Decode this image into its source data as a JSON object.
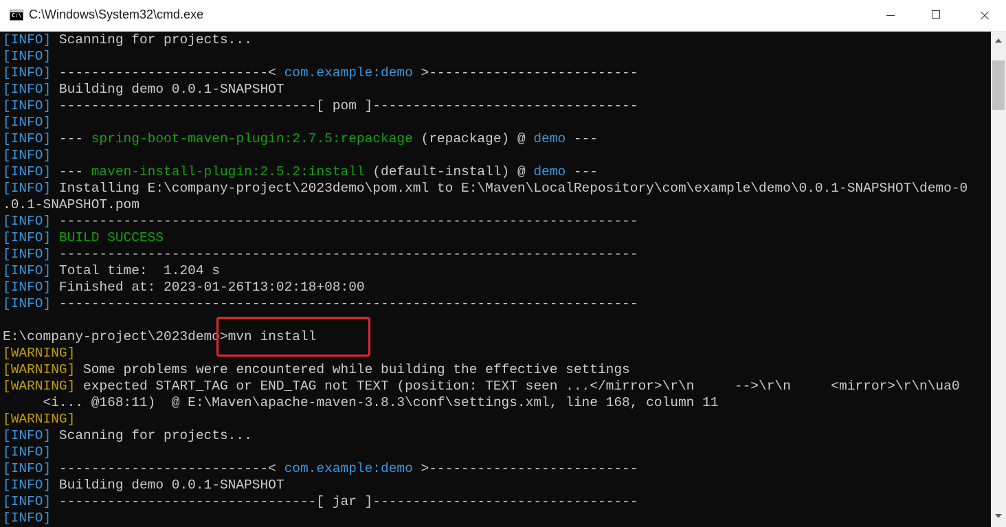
{
  "window": {
    "title": "C:\\Windows\\System32\\cmd.exe",
    "icon_name": "cmd-icon",
    "icon_text": "C:\\",
    "controls": [
      "minimize",
      "maximize",
      "close"
    ]
  },
  "colors": {
    "info": "#3a96dd",
    "warning": "#c19c00",
    "green": "#13a10e",
    "text": "#cccccc",
    "background": "#0c0c0c",
    "highlight": "#e8242c"
  },
  "console": {
    "lines": [
      [
        {
          "t": "[INFO]",
          "c": "info"
        },
        {
          "t": " Scanning for projects..."
        }
      ],
      [
        {
          "t": "[INFO]",
          "c": "info"
        }
      ],
      [
        {
          "t": "[INFO]",
          "c": "info"
        },
        {
          "t": " --------------------------< "
        },
        {
          "t": "com.example:demo",
          "c": "blue"
        },
        {
          "t": " >--------------------------"
        }
      ],
      [
        {
          "t": "[INFO]",
          "c": "info"
        },
        {
          "t": " Building demo 0.0.1-SNAPSHOT"
        }
      ],
      [
        {
          "t": "[INFO]",
          "c": "info"
        },
        {
          "t": " --------------------------------[ pom ]---------------------------------"
        }
      ],
      [
        {
          "t": "[INFO]",
          "c": "info"
        }
      ],
      [
        {
          "t": "[INFO]",
          "c": "info"
        },
        {
          "t": " --- "
        },
        {
          "t": "spring-boot-maven-plugin:2.7.5:repackage",
          "c": "green"
        },
        {
          "t": " (repackage) @ "
        },
        {
          "t": "demo",
          "c": "blue"
        },
        {
          "t": " ---"
        }
      ],
      [
        {
          "t": "[INFO]",
          "c": "info"
        }
      ],
      [
        {
          "t": "[INFO]",
          "c": "info"
        },
        {
          "t": " --- "
        },
        {
          "t": "maven-install-plugin:2.5.2:install",
          "c": "green"
        },
        {
          "t": " (default-install) @ "
        },
        {
          "t": "demo",
          "c": "blue"
        },
        {
          "t": " ---"
        }
      ],
      [
        {
          "t": "[INFO]",
          "c": "info"
        },
        {
          "t": " Installing E:\\company-project\\2023demo\\pom.xml to E:\\Maven\\LocalRepository\\com\\example\\demo\\0.0.1-SNAPSHOT\\demo-0"
        }
      ],
      [
        {
          "t": ".0.1-SNAPSHOT.pom"
        }
      ],
      [
        {
          "t": "[INFO]",
          "c": "info"
        },
        {
          "t": " ------------------------------------------------------------------------"
        }
      ],
      [
        {
          "t": "[INFO]",
          "c": "info"
        },
        {
          "t": " "
        },
        {
          "t": "BUILD SUCCESS",
          "c": "green"
        }
      ],
      [
        {
          "t": "[INFO]",
          "c": "info"
        },
        {
          "t": " ------------------------------------------------------------------------"
        }
      ],
      [
        {
          "t": "[INFO]",
          "c": "info"
        },
        {
          "t": " Total time:  1.204 s"
        }
      ],
      [
        {
          "t": "[INFO]",
          "c": "info"
        },
        {
          "t": " Finished at: 2023-01-26T13:02:18+08:00"
        }
      ],
      [
        {
          "t": "[INFO]",
          "c": "info"
        },
        {
          "t": " ------------------------------------------------------------------------"
        }
      ],
      [],
      [
        {
          "t": "E:\\company-project\\2023demo>mvn install"
        }
      ],
      [
        {
          "t": "[WARNING]",
          "c": "warn"
        }
      ],
      [
        {
          "t": "[WARNING]",
          "c": "warn"
        },
        {
          "t": " Some problems were encountered while building the effective settings"
        }
      ],
      [
        {
          "t": "[WARNING]",
          "c": "warn"
        },
        {
          "t": " expected START_TAG or END_TAG not TEXT (position: TEXT seen ...</mirror>\\r\\n     -->\\r\\n     <mirror>\\r\\n\\ua0"
        }
      ],
      [
        {
          "t": "     <i... @168:11)  @ E:\\Maven\\apache-maven-3.8.3\\conf\\settings.xml, line 168, column 11"
        }
      ],
      [
        {
          "t": "[WARNING]",
          "c": "warn"
        }
      ],
      [
        {
          "t": "[INFO]",
          "c": "info"
        },
        {
          "t": " Scanning for projects..."
        }
      ],
      [
        {
          "t": "[INFO]",
          "c": "info"
        }
      ],
      [
        {
          "t": "[INFO]",
          "c": "info"
        },
        {
          "t": " --------------------------< "
        },
        {
          "t": "com.example:demo",
          "c": "blue"
        },
        {
          "t": " >--------------------------"
        }
      ],
      [
        {
          "t": "[INFO]",
          "c": "info"
        },
        {
          "t": " Building demo 0.0.1-SNAPSHOT"
        }
      ],
      [
        {
          "t": "[INFO]",
          "c": "info"
        },
        {
          "t": " --------------------------------[ jar ]---------------------------------"
        }
      ],
      [
        {
          "t": "[INFO]",
          "c": "info"
        }
      ]
    ]
  }
}
